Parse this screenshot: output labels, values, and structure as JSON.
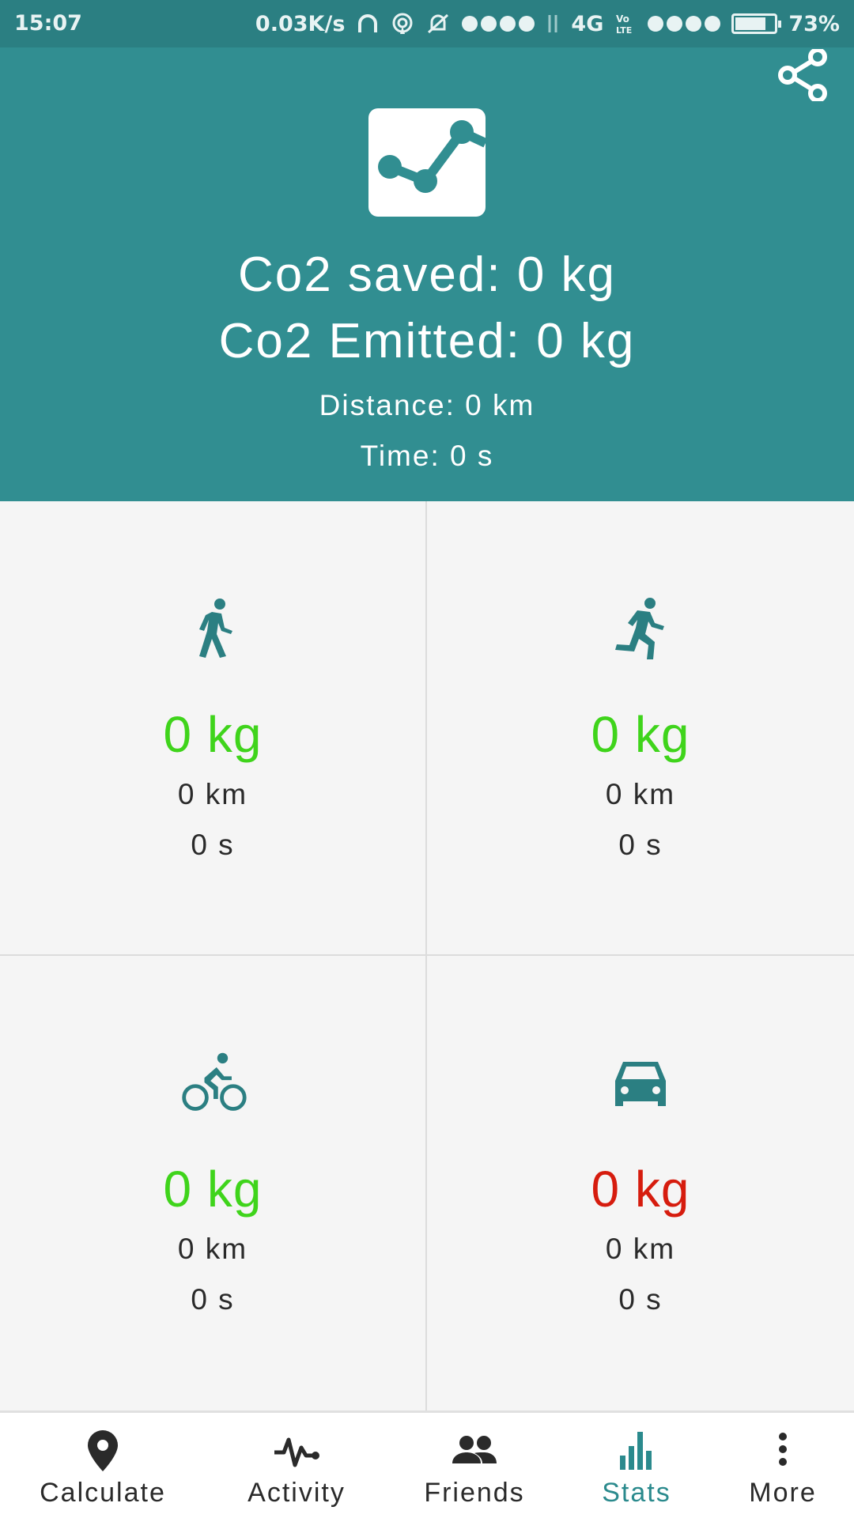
{
  "status_bar": {
    "time": "15:07",
    "speed": "0.03K/s",
    "network": "4G",
    "battery": "73%",
    "battery_level": 0.73
  },
  "header": {
    "co2_saved": "Co2 saved: 0 kg",
    "co2_emitted": "Co2 Emitted: 0 kg",
    "distance": "Distance: 0 km",
    "time": "Time: 0 s",
    "background_color": "#318e91"
  },
  "modes": [
    {
      "icon": "walk-icon",
      "co2": "0 kg",
      "distance": "0 km",
      "time": "0 s",
      "co2_color": "#3fd41b"
    },
    {
      "icon": "run-icon",
      "co2": "0 kg",
      "distance": "0 km",
      "time": "0 s",
      "co2_color": "#3fd41b"
    },
    {
      "icon": "bike-icon",
      "co2": "0 kg",
      "distance": "0 km",
      "time": "0 s",
      "co2_color": "#3fd41b"
    },
    {
      "icon": "car-icon",
      "co2": "0 kg",
      "distance": "0 km",
      "time": "0 s",
      "co2_color": "#d61c0e"
    }
  ],
  "nav": {
    "items": [
      {
        "label": "Calculate",
        "icon": "location-pin-icon"
      },
      {
        "label": "Activity",
        "icon": "pulse-icon"
      },
      {
        "label": "Friends",
        "icon": "people-icon"
      },
      {
        "label": "Stats",
        "icon": "bar-chart-icon"
      },
      {
        "label": "More",
        "icon": "more-vertical-icon"
      }
    ],
    "active": "Stats",
    "active_color": "#2b8a8d"
  }
}
